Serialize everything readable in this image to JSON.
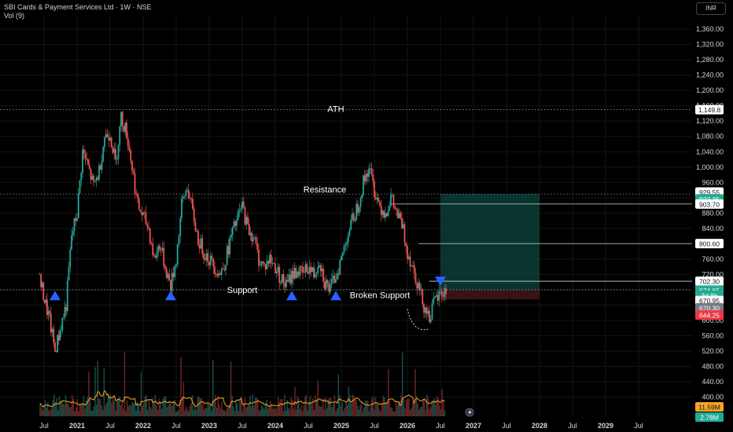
{
  "header": {
    "symbol_title": "SBI Cards & Payment Services Ltd · 1W · NSE",
    "indicator": "Vol (9)"
  },
  "currency_button": "INR",
  "chart_data": {
    "type": "candlestick",
    "title": "SBI Cards & Payment Services Ltd · 1W · NSE",
    "ylim": [
      350,
      1395
    ],
    "y_ticks": [
      400,
      440,
      480,
      520,
      560,
      600,
      640,
      680,
      720,
      760,
      800,
      840,
      880,
      920,
      960,
      1000,
      1040,
      1080,
      1120,
      1160,
      1200,
      1240,
      1280,
      1320,
      1360
    ],
    "y_tick_labels": [
      "400.00",
      "440.00",
      "480.00",
      "520.00",
      "560.00",
      "600.00",
      "640.00",
      "680.00",
      "720.00",
      "760.00",
      "800.00",
      "840.00",
      "880.00",
      "920.00",
      "960.00",
      "1,000.00",
      "1,040.00",
      "1,080.00",
      "1,120.00",
      "1,160.00",
      "1,200.00",
      "1,240.00",
      "1,280.00",
      "1,320.00",
      "1,360.00"
    ],
    "x_labels": [
      "Jul",
      "2021",
      "Jul",
      "2022",
      "Jul",
      "2023",
      "Jul",
      "2024",
      "Jul",
      "2025",
      "Jul",
      "2026",
      "Jul",
      "2027",
      "Jul",
      "2028",
      "Jul",
      "2029",
      "Jul"
    ],
    "price_path": [
      [
        "2020-06",
        720
      ],
      [
        "2020-08",
        600
      ],
      [
        "2020-09",
        520
      ],
      [
        "2020-11",
        640
      ],
      [
        "2020-12",
        820
      ],
      [
        "2021-01",
        880
      ],
      [
        "2021-02",
        1040
      ],
      [
        "2021-03",
        1000
      ],
      [
        "2021-04",
        950
      ],
      [
        "2021-05",
        990
      ],
      [
        "2021-06",
        1080
      ],
      [
        "2021-07",
        1090
      ],
      [
        "2021-08",
        1010
      ],
      [
        "2021-09",
        1130
      ],
      [
        "2021-10",
        1090
      ],
      [
        "2021-11",
        1000
      ],
      [
        "2021-12",
        900
      ],
      [
        "2022-01",
        870
      ],
      [
        "2022-02",
        840
      ],
      [
        "2022-03",
        760
      ],
      [
        "2022-04",
        800
      ],
      [
        "2022-05",
        740
      ],
      [
        "2022-06",
        690
      ],
      [
        "2022-07",
        760
      ],
      [
        "2022-08",
        900
      ],
      [
        "2022-09",
        950
      ],
      [
        "2022-10",
        880
      ],
      [
        "2022-11",
        810
      ],
      [
        "2022-12",
        780
      ],
      [
        "2023-01",
        760
      ],
      [
        "2023-02",
        740
      ],
      [
        "2023-03",
        720
      ],
      [
        "2023-04",
        760
      ],
      [
        "2023-05",
        820
      ],
      [
        "2023-06",
        860
      ],
      [
        "2023-07",
        900
      ],
      [
        "2023-08",
        840
      ],
      [
        "2023-09",
        820
      ],
      [
        "2023-10",
        760
      ],
      [
        "2023-11",
        740
      ],
      [
        "2023-12",
        760
      ],
      [
        "2024-01",
        740
      ],
      [
        "2024-02",
        710
      ],
      [
        "2024-03",
        690
      ],
      [
        "2024-04",
        720
      ],
      [
        "2024-05",
        730
      ],
      [
        "2024-06",
        720
      ],
      [
        "2024-07",
        740
      ],
      [
        "2024-08",
        720
      ],
      [
        "2024-09",
        760
      ],
      [
        "2024-10",
        700
      ],
      [
        "2024-11",
        680
      ],
      [
        "2024-12",
        720
      ],
      [
        "2025-01",
        760
      ],
      [
        "2025-02",
        820
      ],
      [
        "2025-03",
        860
      ],
      [
        "2025-04",
        900
      ],
      [
        "2025-05",
        960
      ],
      [
        "2025-06",
        1000
      ],
      [
        "2025-07",
        940
      ],
      [
        "2025-08",
        900
      ],
      [
        "2025-09",
        880
      ],
      [
        "2025-10",
        920
      ],
      [
        "2025-11",
        880
      ],
      [
        "2025-12",
        850
      ],
      [
        "2026-01",
        780
      ],
      [
        "2026-02",
        740
      ],
      [
        "2026-03",
        690
      ],
      [
        "2026-04",
        640
      ],
      [
        "2026-05",
        610
      ],
      [
        "2026-06",
        650
      ],
      [
        "2026-07",
        670
      ],
      [
        "2026-08",
        674.65
      ]
    ],
    "volume_max_m": 11.59,
    "volume_labels": [
      "11.59M",
      "2.78M"
    ],
    "last_price": 674.65,
    "horizontal_levels": [
      {
        "label": "ATH",
        "value": 1149.8,
        "style": "dotted"
      },
      {
        "label": "Resistance",
        "value": 929.55,
        "style": "dotted"
      },
      {
        "label": "Support",
        "value": 680,
        "style": "dotted"
      }
    ],
    "annotations": [
      {
        "text": "ATH",
        "x": "2024-12",
        "y": 1149.8
      },
      {
        "text": "Resistance",
        "x": "2024-10",
        "y": 940
      },
      {
        "text": "Support",
        "x": "2023-07",
        "y": 678
      },
      {
        "text": "Broken Support",
        "x": "2025-08",
        "y": 665
      }
    ],
    "support_markers": [
      {
        "x": "2020-09",
        "y": 665
      },
      {
        "x": "2022-06",
        "y": 665
      },
      {
        "x": "2024-04",
        "y": 665
      },
      {
        "x": "2024-12",
        "y": 665
      }
    ],
    "entry_marker": {
      "x": "2026-07",
      "y": 702.3
    },
    "position": {
      "x_from": "2026-07",
      "x_to": "2028-01",
      "entry": 680,
      "target": 929.55,
      "stop": 655
    },
    "ray_levels": [
      {
        "value": 903.7,
        "x_from": "2025-10"
      },
      {
        "value": 800.6,
        "x_from": "2026-03"
      },
      {
        "value": 702.3,
        "x_from": "2026-05"
      }
    ],
    "price_tags": [
      {
        "text": "1,149.8",
        "value": 1149.8,
        "bg": "#ffffff",
        "fg": "#131722"
      },
      {
        "text": "929.55",
        "value": 935,
        "bg": "#ffffff",
        "fg": "#131722"
      },
      {
        "text": "927.35",
        "value": 917,
        "bg": "#22ab94",
        "fg": "#ffffff"
      },
      {
        "text": "903.70",
        "value": 903.7,
        "bg": "#ffffff",
        "fg": "#131722"
      },
      {
        "text": "800.60",
        "value": 800.6,
        "bg": "#ffffff",
        "fg": "#131722"
      },
      {
        "text": "702.30",
        "value": 702.3,
        "bg": "#ffffff",
        "fg": "#131722"
      },
      {
        "text": "674.65",
        "value": 679,
        "bg": "#22ab94",
        "fg": "#ffffff"
      },
      {
        "text": "3d 8h",
        "value": 666,
        "bg": "#22ab94",
        "fg": "#ffffff"
      },
      {
        "text": "670.95",
        "value": 652,
        "bg": "#ffffff",
        "fg": "#131722"
      },
      {
        "text": "670.30",
        "value": 633,
        "bg": "#787b86",
        "fg": "#ffffff"
      },
      {
        "text": "644.25",
        "value": 614,
        "bg": "#f23645",
        "fg": "#ffffff"
      }
    ],
    "colors": {
      "up": "#26a69a",
      "down": "#ef5350",
      "target_zone": "#0b3a33",
      "stop_zone": "#3d1216",
      "marker": "#2962ff",
      "volume_ma": "#f5a623",
      "grid": "#141414",
      "axis_text": "#d1d4dc"
    }
  }
}
